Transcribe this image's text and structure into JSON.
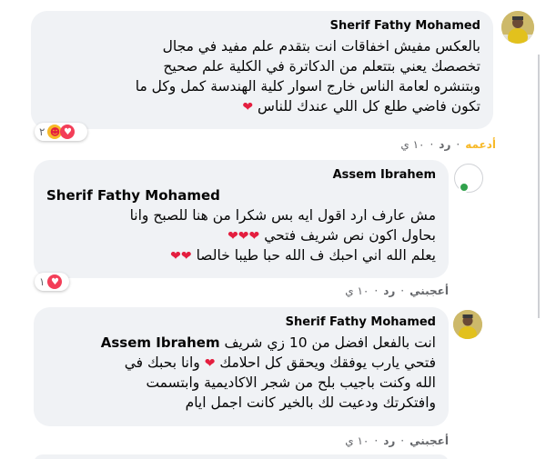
{
  "comments": [
    {
      "author": "Sherif Fathy Mohamed",
      "lines": [
        "بالعكس مفيش اخفاقات انت بتقدم علم مفيد في مجال",
        "تخصصك يعني بتتعلم من الدكاترة في الكلية علم صحيح",
        "وبتنشره لعامة الناس خارج اسوار كلية الهندسة كمل وكل ما",
        "تكون فاضي طلع كل اللي عندك للناس"
      ],
      "reaction_count": "٢",
      "actions": {
        "like": "أدعمه",
        "reply": "رد",
        "time": "١٠ ي"
      }
    },
    {
      "author": "Assem Ibrahem",
      "mention": "Sherif Fathy Mohamed",
      "lines": [
        "مش عارف ارد اقول ايه بس شكرا من هنا للصبح وانا",
        "بحاول اكون نص شريف فتحي",
        "يعلم الله اني احبك ف الله حبا طيبا خالصا"
      ],
      "reaction_count": "١",
      "actions": {
        "like": "أعجبني",
        "reply": "رد",
        "time": "١٠ ي"
      }
    },
    {
      "author": "Sherif Fathy Mohamed",
      "mention": "Assem Ibrahem",
      "first_line_text": "انت بالفعل افضل من 10 زي شريف",
      "lines": [
        "فتحي يارب يوفقك ويحقق كل احلامك",
        "وانا بحبك في",
        "الله وكنت باجيب بلح من شجر الاكاديمية وابتسمت",
        "وافتكرتك ودعيت لك بالخير كانت اجمل ايام"
      ],
      "actions": {
        "like": "أعجبني",
        "reply": "رد",
        "time": "١٠ ي"
      }
    }
  ],
  "colors": {
    "bubble": "#f0f2f5",
    "heart": "#e41e3f",
    "muted": "#65676b",
    "support": "#f7b928",
    "online": "#31a24c"
  }
}
